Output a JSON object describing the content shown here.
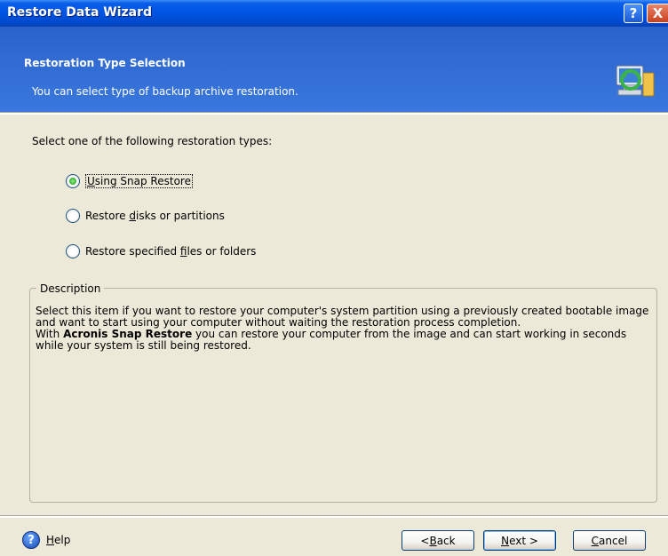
{
  "window": {
    "title": "Restore Data Wizard",
    "help_button": "?",
    "close_button": "X"
  },
  "header": {
    "title": "Restoration Type Selection",
    "subtitle": "You can select type of backup archive restoration."
  },
  "main": {
    "prompt": "Select one of the following restoration types:",
    "options": [
      {
        "label_pre": "",
        "mnemonic": "U",
        "label_post": "sing Snap Restore",
        "selected": true
      },
      {
        "label_pre": "Restore ",
        "mnemonic": "d",
        "label_post": "isks or partitions",
        "selected": false
      },
      {
        "label_pre": "Restore specified ",
        "mnemonic": "f",
        "label_post": "iles or folders",
        "selected": false
      }
    ]
  },
  "description": {
    "legend": "Description",
    "line1": "Select this item if you want to restore your computer's system partition using a previously created bootable image and want to start using your computer without waiting the restoration process completion.",
    "line2_pre": "With ",
    "line2_bold": "Acronis Snap Restore",
    "line2_post": " you can restore your computer from the image and can start working in seconds while your system is still being restored."
  },
  "footer": {
    "help_mnemonic": "H",
    "help_rest": "elp",
    "back_pre": "< ",
    "back_mnemonic": "B",
    "back_rest": "ack",
    "next_mnemonic": "N",
    "next_rest": "ext >",
    "cancel_mnemonic": "C",
    "cancel_rest": "ancel"
  }
}
